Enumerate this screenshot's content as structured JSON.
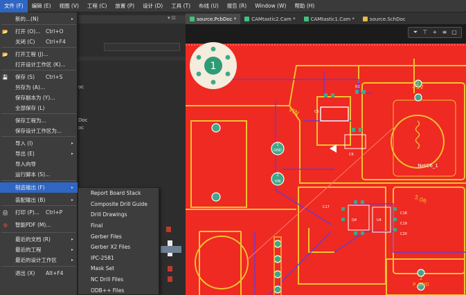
{
  "menubar": {
    "items": [
      "文件 (F)",
      "编辑 (E)",
      "视图 (V)",
      "工程 (C)",
      "放置 (P)",
      "设计 (D)",
      "工具 (T)",
      "布线 (U)",
      "报告 (R)",
      "Window (W)",
      "帮助 (H)"
    ]
  },
  "tabs": [
    {
      "label": "source.PcbDoc *",
      "color": "#3cc47c"
    },
    {
      "label": "CAMtastic2.Cam *",
      "color": "#3cc47c"
    },
    {
      "label": "CAMtastic1.Cam *",
      "color": "#3cc47c"
    },
    {
      "label": "source.SchDoc",
      "color": "#e8b84a"
    }
  ],
  "left_panel": {
    "fragment_oc1": "oc",
    "fragment_oc2": "Doc",
    "fragment_oc3": "oc"
  },
  "file_menu": {
    "items": [
      {
        "label": "新的...(N)",
        "shortcut": "",
        "arrow": "▸",
        "icon": ""
      },
      {
        "label": "打开 (O)...",
        "shortcut": "Ctrl+O",
        "arrow": "",
        "icon": "folder-icon"
      },
      {
        "label": "关闭 (C)",
        "shortcut": "Ctrl+F4",
        "arrow": "",
        "icon": ""
      },
      {
        "label": "打开工程 (J)...",
        "shortcut": "",
        "arrow": "",
        "icon": "folder-icon"
      },
      {
        "label": "打开设计工作区 (K)...",
        "shortcut": "",
        "arrow": "",
        "icon": ""
      },
      {
        "label": "保存 (S)",
        "shortcut": "Ctrl+S",
        "arrow": "",
        "icon": "save-icon"
      },
      {
        "label": "另存为 (A)...",
        "shortcut": "",
        "arrow": "",
        "icon": ""
      },
      {
        "label": "保存副本为 (Y)...",
        "shortcut": "",
        "arrow": "",
        "icon": ""
      },
      {
        "label": "全部保存 (L)",
        "shortcut": "",
        "arrow": "",
        "icon": ""
      },
      {
        "label": "保存工程为...",
        "shortcut": "",
        "arrow": "",
        "icon": ""
      },
      {
        "label": "保存设计工作区为...",
        "shortcut": "",
        "arrow": "",
        "icon": ""
      },
      {
        "label": "导入 (I)",
        "shortcut": "",
        "arrow": "▸",
        "icon": ""
      },
      {
        "label": "导出 (E)",
        "shortcut": "",
        "arrow": "▸",
        "icon": ""
      },
      {
        "label": "导入向导",
        "shortcut": "",
        "arrow": "",
        "icon": ""
      },
      {
        "label": "运行脚本 (S)...",
        "shortcut": "",
        "arrow": "",
        "icon": ""
      },
      {
        "label": "制造输出 (F)",
        "shortcut": "",
        "arrow": "▸",
        "icon": ""
      },
      {
        "label": "装配输出 (B)",
        "shortcut": "",
        "arrow": "▸",
        "icon": ""
      },
      {
        "label": "打印 (P)...",
        "shortcut": "Ctrl+P",
        "arrow": "",
        "icon": "print-icon"
      },
      {
        "label": "智能PDF (M)...",
        "shortcut": "",
        "arrow": "",
        "icon": "pdf-icon"
      },
      {
        "label": "最近的文档 (R)",
        "shortcut": "",
        "arrow": "▸",
        "icon": ""
      },
      {
        "label": "最近的工程",
        "shortcut": "",
        "arrow": "▸",
        "icon": ""
      },
      {
        "label": "最近的设计工作区",
        "shortcut": "",
        "arrow": "▸",
        "icon": ""
      },
      {
        "label": "退出 (X)",
        "shortcut": "Alt+F4",
        "arrow": "",
        "icon": ""
      }
    ]
  },
  "submenu": {
    "items": [
      "Report Board Stack",
      "Composite Drill Guide",
      "Drill Drawings",
      "Final",
      "Gerber Files",
      "Gerber X2 Files",
      "IPC-2581",
      "Mask Set",
      "NC Drill Files",
      "ODB++ Files"
    ]
  },
  "pcb": {
    "fiducial_label": "1",
    "labels": {
      "vin": "VIN",
      "gnd1": "GND",
      "gnd1_num": "1",
      "vin_small": "VIN",
      "vin_num": "2",
      "plus5v": "+5V",
      "num2": "2",
      "netc6": "NetC6_1",
      "sdr": "5.0R",
      "p_gnd": "P_GND",
      "num2b": "2",
      "c6": "C6",
      "c5": "C5",
      "r1": "R1",
      "c17": "C17",
      "c19": "C19",
      "c18": "C18",
      "c20": "C20",
      "q4": "Q4",
      "u4": "U4"
    },
    "colors": {
      "board": "#ee2a22",
      "trace": "#f2c230",
      "bottom_trace": "#6a3ad0",
      "pad": "#3fa88a"
    }
  }
}
